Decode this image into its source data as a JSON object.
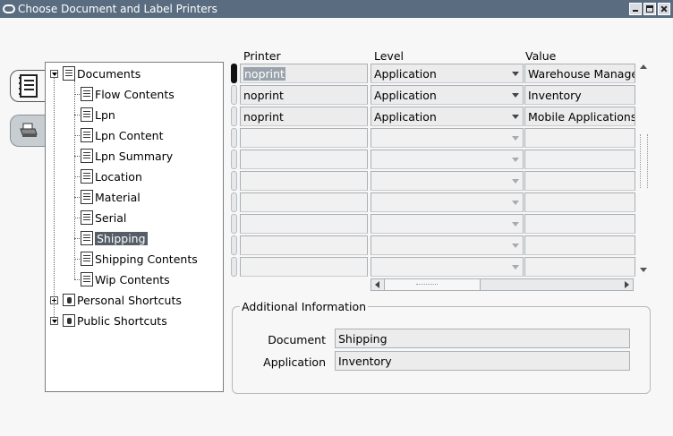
{
  "window": {
    "title": "Choose Document and Label Printers"
  },
  "tabs": [
    {
      "name": "documents-tab",
      "icon": "document-list-icon"
    },
    {
      "name": "printer-tab",
      "icon": "printer-icon"
    }
  ],
  "tree": {
    "root_label": "Documents",
    "children": [
      "Flow Contents",
      "Lpn",
      "Lpn Content",
      "Lpn Summary",
      "Location",
      "Material",
      "Serial",
      "Shipping",
      "Shipping Contents",
      "Wip Contents"
    ],
    "selected": "Shipping",
    "personal_shortcuts": "Personal Shortcuts",
    "public_shortcuts": "Public Shortcuts"
  },
  "grid": {
    "headers": {
      "printer": "Printer",
      "level": "Level",
      "value": "Value"
    },
    "rows": [
      {
        "printer": "noprint",
        "level": "Application",
        "value": "Warehouse Manager"
      },
      {
        "printer": "noprint",
        "level": "Application",
        "value": "Inventory"
      },
      {
        "printer": "noprint",
        "level": "Application",
        "value": "Mobile Applications f"
      }
    ],
    "empty_rows": 6
  },
  "additional_info": {
    "title": "Additional Information",
    "document_label": "Document",
    "document_value": "Shipping",
    "application_label": "Application",
    "application_value": "Inventory"
  }
}
